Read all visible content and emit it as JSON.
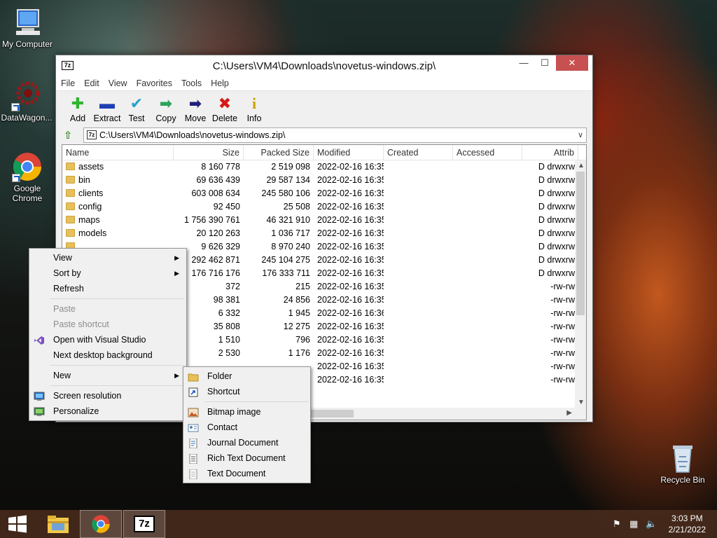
{
  "desktop": {
    "icons": [
      {
        "label": "My Computer",
        "icon": "computer-icon"
      },
      {
        "label": "DataWagon...",
        "icon": "datawagon-icon"
      },
      {
        "label": "Google Chrome",
        "icon": "chrome-icon"
      },
      {
        "label": "Recycle Bin",
        "icon": "recycle-bin-icon"
      }
    ]
  },
  "window": {
    "title": "C:\\Users\\VM4\\Downloads\\novetus-windows.zip\\",
    "app_icon_text": "7z",
    "controls": {
      "minimize": "—",
      "maximize": "☐",
      "close": "✕"
    },
    "menu": [
      "File",
      "Edit",
      "View",
      "Favorites",
      "Tools",
      "Help"
    ],
    "toolbar": [
      {
        "label": "Add",
        "glyph": "✚",
        "color": "#2fb52f"
      },
      {
        "label": "Extract",
        "glyph": "▬",
        "color": "#1f3fb5"
      },
      {
        "label": "Test",
        "glyph": "✔",
        "color": "#27a3c9"
      },
      {
        "label": "Copy",
        "glyph": "➡",
        "color": "#2ca35b"
      },
      {
        "label": "Move",
        "glyph": "➡",
        "color": "#20207a"
      },
      {
        "label": "Delete",
        "glyph": "✖",
        "color": "#d81818"
      },
      {
        "label": "Info",
        "glyph": "i",
        "color": "#c9a400"
      }
    ],
    "address": "C:\\Users\\VM4\\Downloads\\novetus-windows.zip\\",
    "columns": [
      "Name",
      "Size",
      "Packed Size",
      "Modified",
      "Created",
      "Accessed",
      "Attrib"
    ],
    "rows": [
      {
        "name": "assets",
        "folder": true,
        "size": "8 160 778",
        "packed": "2 519 098",
        "modified": "2022-02-16 16:35",
        "attrib": "D drwxrw"
      },
      {
        "name": "bin",
        "folder": true,
        "size": "69 636 439",
        "packed": "29 587 134",
        "modified": "2022-02-16 16:35",
        "attrib": "D drwxrw"
      },
      {
        "name": "clients",
        "folder": true,
        "size": "603 008 634",
        "packed": "245 580 106",
        "modified": "2022-02-16 16:35",
        "attrib": "D drwxrw"
      },
      {
        "name": "config",
        "folder": true,
        "size": "92 450",
        "packed": "25 508",
        "modified": "2022-02-16 16:35",
        "attrib": "D drwxrw"
      },
      {
        "name": "maps",
        "folder": true,
        "size": "1 756 390 761",
        "packed": "46 321 910",
        "modified": "2022-02-16 16:35",
        "attrib": "D drwxrw"
      },
      {
        "name": "models",
        "folder": true,
        "size": "20 120 263",
        "packed": "1 036 717",
        "modified": "2022-02-16 16:35",
        "attrib": "D drwxrw"
      },
      {
        "name": "",
        "folder": true,
        "size": "9 626 329",
        "packed": "8 970 240",
        "modified": "2022-02-16 16:35",
        "attrib": "D drwxrw"
      },
      {
        "name": "",
        "folder": true,
        "size": "292 462 871",
        "packed": "245 104 275",
        "modified": "2022-02-16 16:35",
        "attrib": "D drwxrw"
      },
      {
        "name": "",
        "folder": true,
        "size": "176 716 176",
        "packed": "176 333 711",
        "modified": "2022-02-16 16:35",
        "attrib": "D drwxrw"
      },
      {
        "name": "",
        "folder": false,
        "size": "372",
        "packed": "215",
        "modified": "2022-02-16 16:35",
        "attrib": "-rw-rw"
      },
      {
        "name": "",
        "folder": false,
        "size": "98 381",
        "packed": "24 856",
        "modified": "2022-02-16 16:35",
        "attrib": "-rw-rw"
      },
      {
        "name": "",
        "folder": false,
        "size": "6 332",
        "packed": "1 945",
        "modified": "2022-02-16 16:36",
        "attrib": "-rw-rw"
      },
      {
        "name": "",
        "folder": false,
        "size": "35 808",
        "packed": "12 275",
        "modified": "2022-02-16 16:35",
        "attrib": "-rw-rw"
      },
      {
        "name": "",
        "folder": false,
        "size": "1 510",
        "packed": "796",
        "modified": "2022-02-16 16:35",
        "attrib": "-rw-rw"
      },
      {
        "name": "",
        "folder": false,
        "size": "2 530",
        "packed": "1 176",
        "modified": "2022-02-16 16:35",
        "attrib": "-rw-rw"
      },
      {
        "name": "",
        "folder": false,
        "size": "",
        "packed": "",
        "modified": "2022-02-16 16:35",
        "attrib": "-rw-rw"
      },
      {
        "name": "",
        "folder": false,
        "size": "",
        "packed": "",
        "modified": "2022-02-16 16:35",
        "attrib": "-rw-rw"
      }
    ]
  },
  "context_menu": {
    "items": [
      {
        "label": "View",
        "submenu": true
      },
      {
        "label": "Sort by",
        "submenu": true
      },
      {
        "label": "Refresh"
      },
      {
        "sep": true
      },
      {
        "label": "Paste",
        "disabled": true
      },
      {
        "label": "Paste shortcut",
        "disabled": true
      },
      {
        "label": "Open with Visual Studio",
        "icon": "visual-studio-icon"
      },
      {
        "label": "Next desktop background"
      },
      {
        "sep": true
      },
      {
        "label": "New",
        "submenu": true
      },
      {
        "sep": true
      },
      {
        "label": "Screen resolution",
        "icon": "screen-resolution-icon"
      },
      {
        "label": "Personalize",
        "icon": "personalize-icon"
      }
    ]
  },
  "new_submenu": {
    "items": [
      {
        "label": "Folder",
        "icon": "folder-icon"
      },
      {
        "label": "Shortcut",
        "icon": "shortcut-icon"
      },
      {
        "sep": true
      },
      {
        "label": "Bitmap image",
        "icon": "bitmap-image-icon"
      },
      {
        "label": "Contact",
        "icon": "contact-icon"
      },
      {
        "label": "Journal Document",
        "icon": "journal-document-icon"
      },
      {
        "label": "Rich Text Document",
        "icon": "rich-text-document-icon"
      },
      {
        "label": "Text Document",
        "icon": "text-document-icon"
      }
    ]
  },
  "taskbar": {
    "clock_time": "3:03 PM",
    "clock_date": "2/21/2022",
    "pinned": [
      "file-explorer-icon",
      "chrome-icon",
      "7zip-icon"
    ],
    "seven_zip_label": "7z"
  }
}
